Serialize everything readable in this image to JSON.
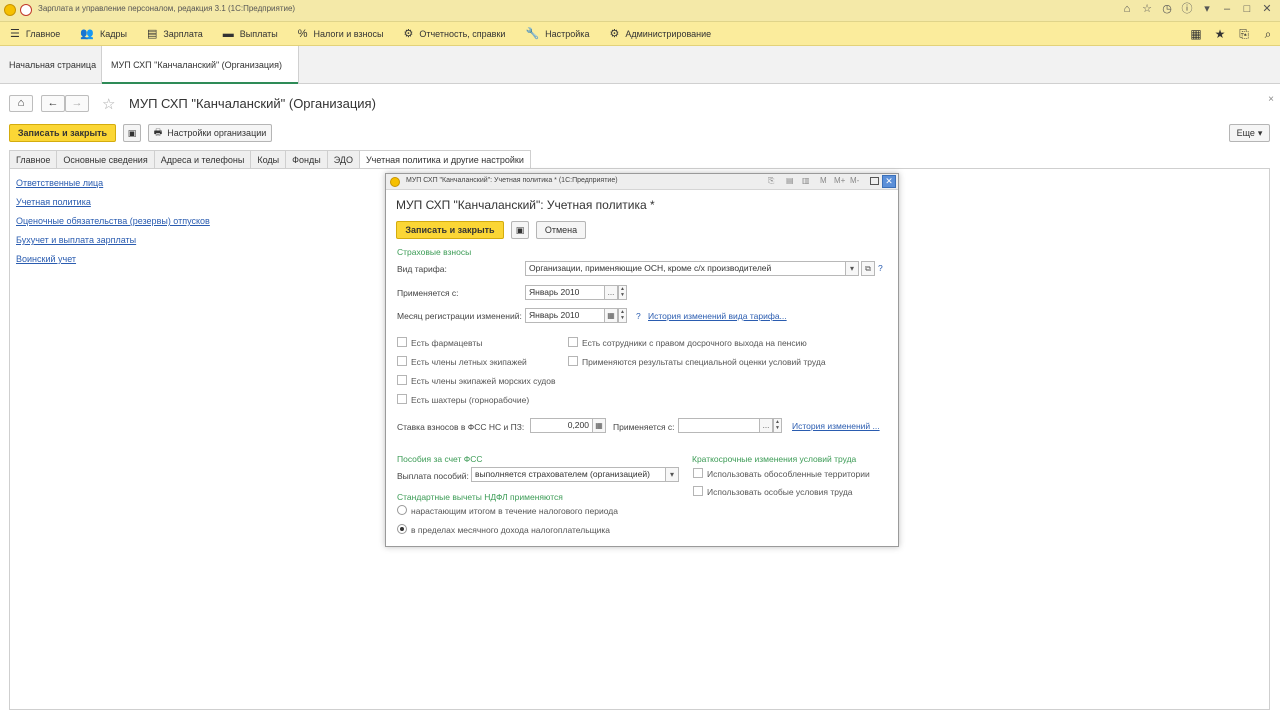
{
  "app": {
    "title": "Зарплата и управление персоналом, редакция 3.1 (1С:Предприятие)"
  },
  "main_menu": {
    "items": [
      {
        "label": "Главное",
        "icon": "☰"
      },
      {
        "label": "Кадры",
        "icon": "👥"
      },
      {
        "label": "Зарплата",
        "icon": "▤"
      },
      {
        "label": "Выплаты",
        "icon": "▬"
      },
      {
        "label": "Налоги и взносы",
        "icon": "%"
      },
      {
        "label": "Отчетность, справки",
        "icon": "⚙"
      },
      {
        "label": "Настройка",
        "icon": "🔧"
      },
      {
        "label": "Администрирование",
        "icon": "⚙"
      }
    ]
  },
  "window_tabs": {
    "home": "Начальная страница",
    "active": "МУП СХП \"Канчаланский\" (Организация)"
  },
  "form": {
    "title": "МУП СХП \"Канчаланский\" (Организация)",
    "save_close": "Записать и закрыть",
    "org_settings": "Настройки организации",
    "more": "Еще",
    "tabs": [
      "Главное",
      "Основные сведения",
      "Адреса и телефоны",
      "Коды",
      "Фонды",
      "ЭДО",
      "Учетная политика и другие настройки"
    ],
    "links": [
      "Ответственные лица",
      "Учетная политика",
      "Оценочные обязательства (резервы) отпусков",
      "Бухучет и выплата зарплаты",
      "Воинский учет"
    ]
  },
  "dialog": {
    "window_title": "МУП СХП \"Канчаланский\": Учетная политика * (1С:Предприятие)",
    "heading": "МУП СХП \"Канчаланский\": Учетная политика *",
    "save_close": "Записать и закрыть",
    "cancel": "Отмена",
    "insurance_section": "Страховые взносы",
    "tariff_label": "Вид тарифа:",
    "tariff_value": "Организации, применяющие ОСН, кроме с/х производителей",
    "applies_from_label": "Применяется с:",
    "applies_from_value": "Январь 2010",
    "reg_month_label": "Месяц регистрации изменений:",
    "reg_month_value": "Январь 2010",
    "tariff_history_link": "История изменений вида тарифа...",
    "checkboxes_left": [
      "Есть фармацевты",
      "Есть члены летных экипажей",
      "Есть члены экипажей морских судов",
      "Есть шахтеры (горнорабочие)"
    ],
    "checkboxes_right": [
      "Есть сотрудники с правом досрочного выхода на пенсию",
      "Применяются результаты специальной оценки условий труда"
    ],
    "fss_rate_label": "Ставка взносов в ФСС НС и ПЗ:",
    "fss_rate_value": "0,200",
    "fss_applies_label": "Применяется с:",
    "fss_history_link": "История изменений ...",
    "benefits_section": "Пособия за счет ФСС",
    "payment_label": "Выплата пособий:",
    "payment_value": "выполняется страхователем (организацией)",
    "short_term_section": "Краткосрочные изменения условий труда",
    "short_term_cb": [
      "Использовать обособленные территории",
      "Использовать особые условия труда"
    ],
    "ndfl_section": "Стандартные вычеты НДФЛ применяются",
    "radio_options": [
      "нарастающим итогом в течение налогового периода",
      "в пределах месячного дохода налогоплательщика"
    ],
    "radio_selected": 1
  }
}
